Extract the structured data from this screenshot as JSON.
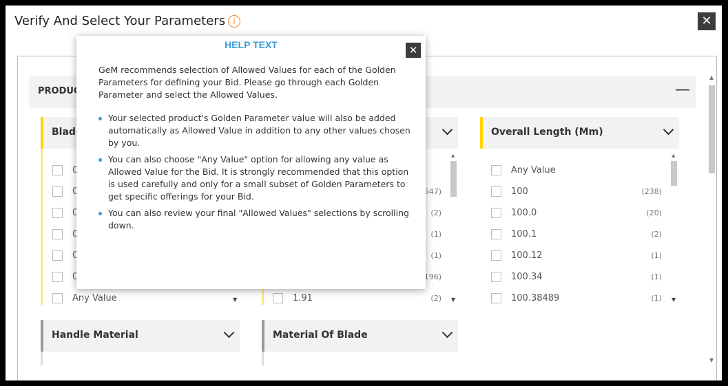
{
  "modal": {
    "title": "Verify And Select Your Parameters",
    "info_glyph": "i",
    "close_glyph": "✕"
  },
  "section": {
    "label": "PRODUCT",
    "collapse_glyph": "—"
  },
  "col1": {
    "title": "Blade",
    "items": [
      {
        "value": "0",
        "count": ""
      },
      {
        "value": "0",
        "count": ""
      },
      {
        "value": "0",
        "count": ""
      },
      {
        "value": "0",
        "count": ""
      },
      {
        "value": "0",
        "count": ""
      },
      {
        "value": "0",
        "count": ""
      },
      {
        "value": "Any Value",
        "count": ""
      }
    ]
  },
  "col2": {
    "title": "",
    "items": [
      {
        "value": "",
        "count": "547)"
      },
      {
        "value": "",
        "count": "(2)"
      },
      {
        "value": "",
        "count": "(1)"
      },
      {
        "value": "",
        "count": "(1)"
      },
      {
        "value": "",
        "count": "196)"
      },
      {
        "value": "1.91",
        "count": "(2)"
      }
    ]
  },
  "col3": {
    "title": "Overall Length (Mm)",
    "items": [
      {
        "value": "Any Value",
        "count": ""
      },
      {
        "value": "100",
        "count": "(238)"
      },
      {
        "value": "100.0",
        "count": "(20)"
      },
      {
        "value": "100.1",
        "count": "(2)"
      },
      {
        "value": "100.12",
        "count": "(1)"
      },
      {
        "value": "100.34",
        "count": "(1)"
      },
      {
        "value": "100.38489",
        "count": "(1)"
      }
    ]
  },
  "row2": {
    "handle_material": "Handle Material",
    "material_of_blade": "Material Of Blade"
  },
  "help": {
    "title": "HELP TEXT",
    "close_glyph": "✕",
    "intro": "GeM recommends selection of Allowed Values for each of the Golden Parameters for defining your Bid. Please go through each Golden Parameter and select the Allowed Values.",
    "bullets": [
      "Your selected product's Golden Parameter value will also be added automatically as Allowed Value in addition to any other values chosen by you.",
      "You can also choose \"Any Value\" option for allowing any value as Allowed Value for the Bid. It is strongly recommended that this option is used carefully and only for a small subset of Golden Parameters to get specific offerings for your Bid.",
      "You can also review your final \"Allowed Values\" selections by scrolling down."
    ]
  },
  "colors": {
    "accent_yellow": "#ffd400",
    "help_blue": "#3a9ad9",
    "info_orange": "#f08a2a"
  }
}
